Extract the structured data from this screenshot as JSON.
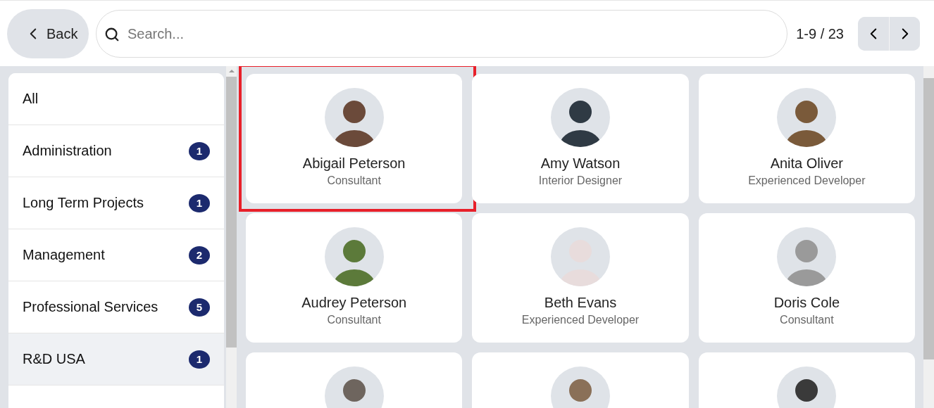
{
  "toolbar": {
    "back_label": "Back",
    "search": {
      "placeholder": "Search..."
    },
    "pager": "1-9 / 23"
  },
  "sidebar": {
    "items": [
      {
        "label": "All",
        "selected": false
      },
      {
        "label": "Administration",
        "count": "1",
        "selected": false
      },
      {
        "label": "Long Term Projects",
        "count": "1",
        "selected": false
      },
      {
        "label": "Management",
        "count": "2",
        "selected": false
      },
      {
        "label": "Professional Services",
        "count": "5",
        "selected": false
      },
      {
        "label": "R&D USA",
        "count": "1",
        "selected": true
      }
    ]
  },
  "cards": [
    {
      "name": "Abigail Peterson",
      "role": "Consultant",
      "highlighted": true,
      "color": "#6b4a3a"
    },
    {
      "name": "Amy Watson",
      "role": "Interior Designer",
      "highlighted": false,
      "color": "#2f3a44"
    },
    {
      "name": "Anita Oliver",
      "role": "Experienced Developer",
      "highlighted": false,
      "color": "#7a5a3a"
    },
    {
      "name": "Audrey Peterson",
      "role": "Consultant",
      "highlighted": false,
      "color": "#5c7a3a"
    },
    {
      "name": "Beth Evans",
      "role": "Experienced Developer",
      "highlighted": false,
      "color": "#e8dcdc"
    },
    {
      "name": "Doris Cole",
      "role": "Consultant",
      "highlighted": false,
      "color": "#9a9a9a"
    },
    {
      "highlighted": false,
      "color": "#6e655e"
    },
    {
      "highlighted": false,
      "color": "#8a7058"
    },
    {
      "highlighted": false,
      "color": "#3a3a3a"
    }
  ]
}
